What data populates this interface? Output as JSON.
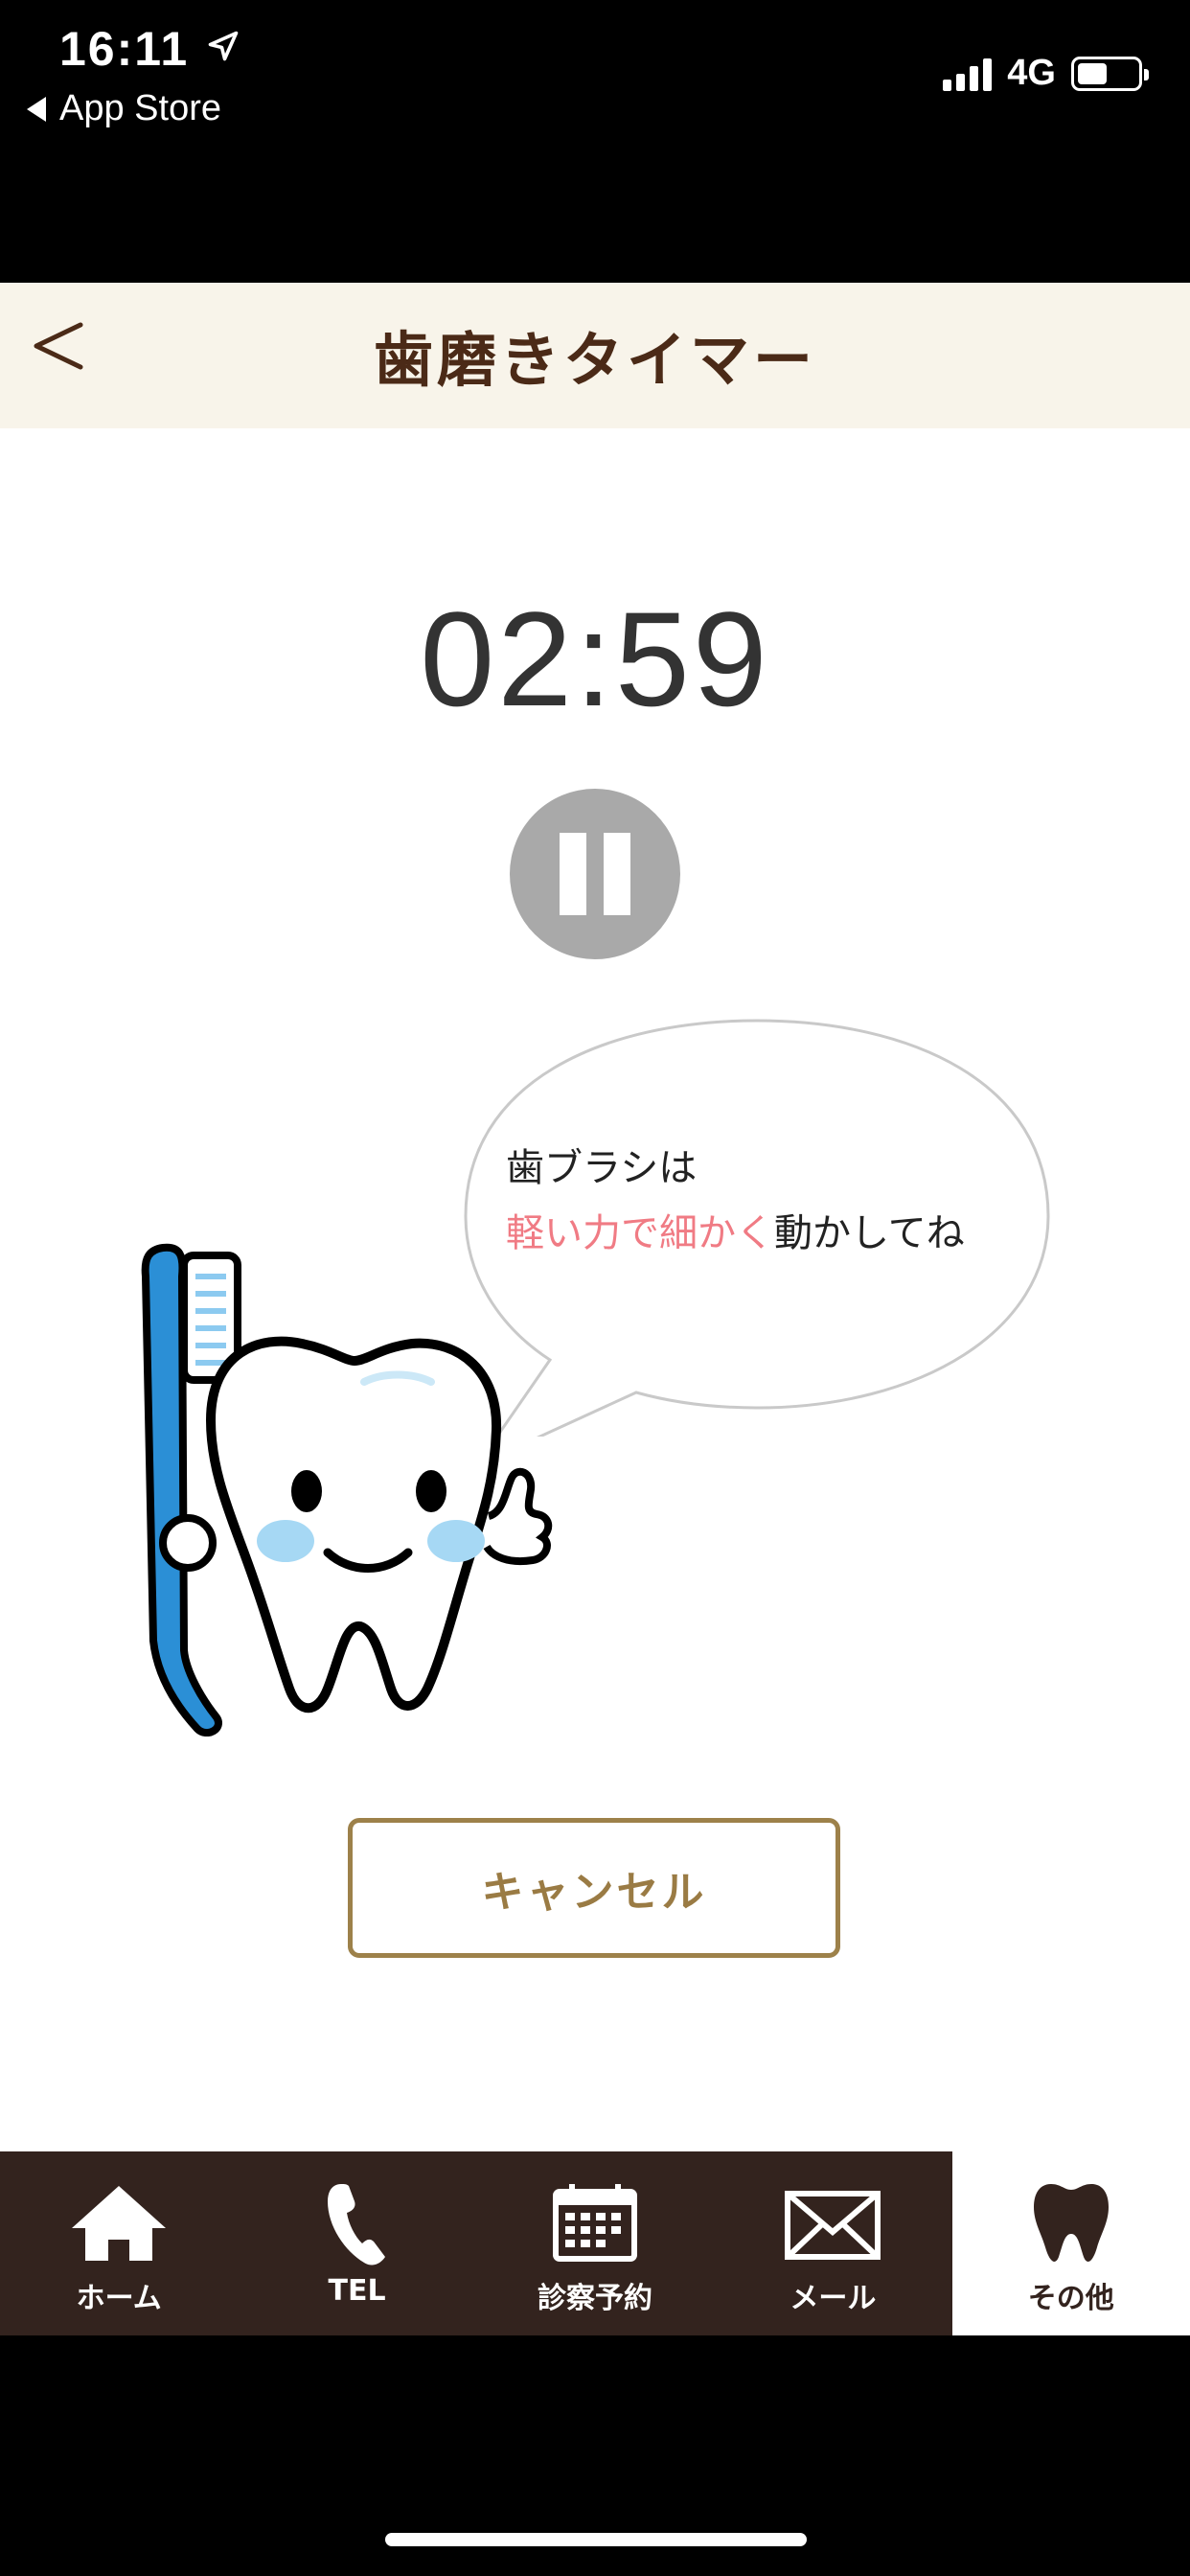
{
  "status_bar": {
    "time": "16:11",
    "back_app": "App Store",
    "network": "4G"
  },
  "header": {
    "title": "歯磨きタイマー"
  },
  "timer": {
    "display": "02:59"
  },
  "speech_bubble": {
    "line1": "歯ブラシは",
    "line2_highlight": "軽い力で細かく",
    "line2_rest": "動かしてね"
  },
  "actions": {
    "cancel_label": "キャンセル"
  },
  "tab_bar": {
    "tabs": [
      {
        "label": "ホーム",
        "icon": "home-icon"
      },
      {
        "label": "TEL",
        "icon": "phone-icon"
      },
      {
        "label": "診察予約",
        "icon": "calendar-icon"
      },
      {
        "label": "メール",
        "icon": "mail-icon"
      },
      {
        "label": "その他",
        "icon": "tooth-icon"
      }
    ],
    "active_index": 4
  },
  "colors": {
    "header_bg": "#f8f4ea",
    "title": "#4b2a17",
    "accent_pink": "#f07b84",
    "cancel_border": "#9d814a",
    "tab_bar_bg": "#33231e"
  }
}
